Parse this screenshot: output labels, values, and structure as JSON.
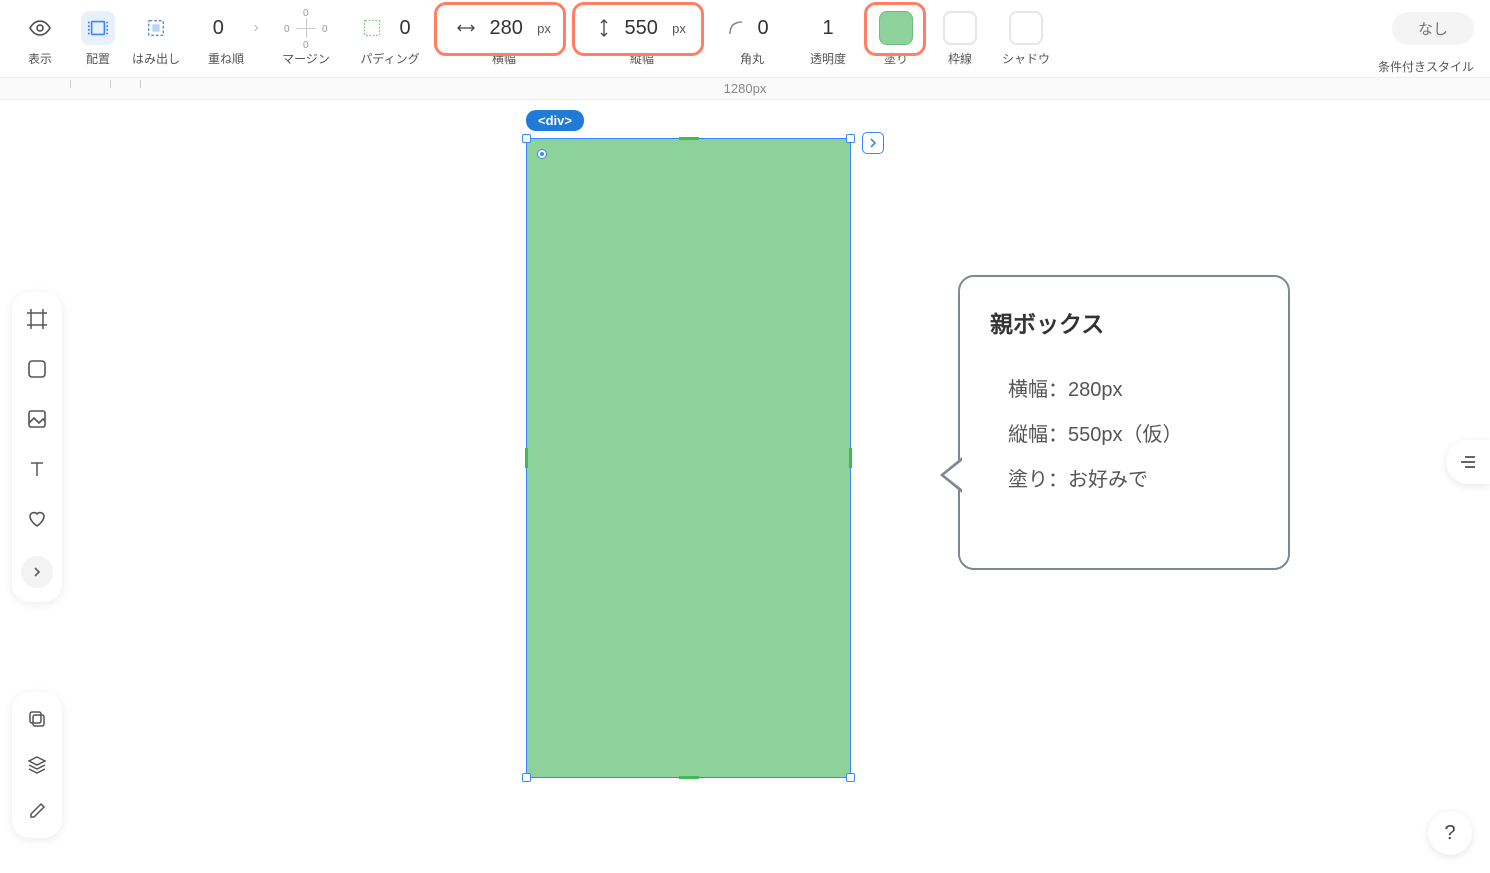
{
  "toolbar": {
    "display_label": "表示",
    "layout_label": "配置",
    "overflow_label": "はみ出し",
    "zindex_label": "重ね順",
    "zindex_value": "0",
    "margin_label": "マージン",
    "margin_top": "0",
    "margin_right": "0",
    "margin_bottom": "0",
    "margin_left": "0",
    "padding_label": "パディング",
    "padding_value": "0",
    "width_label": "横幅",
    "width_value": "280",
    "width_unit": "px",
    "height_label": "縦幅",
    "height_value": "550",
    "height_unit": "px",
    "radius_label": "角丸",
    "radius_value": "0",
    "opacity_label": "透明度",
    "opacity_value": "1",
    "fill_label": "塗り",
    "border_label": "枠線",
    "shadow_label": "シャドウ",
    "none_label": "なし",
    "cond_style_label": "条件付きスタイル"
  },
  "ruler": {
    "width_label": "1280px"
  },
  "canvas": {
    "element_tag": "<div>"
  },
  "callout": {
    "title": "親ボックス",
    "line1": "横幅：280px",
    "line2": "縦幅：550px（仮）",
    "line3": "塗り：お好みで"
  },
  "fill_color": "#8ed29b",
  "help": "?"
}
